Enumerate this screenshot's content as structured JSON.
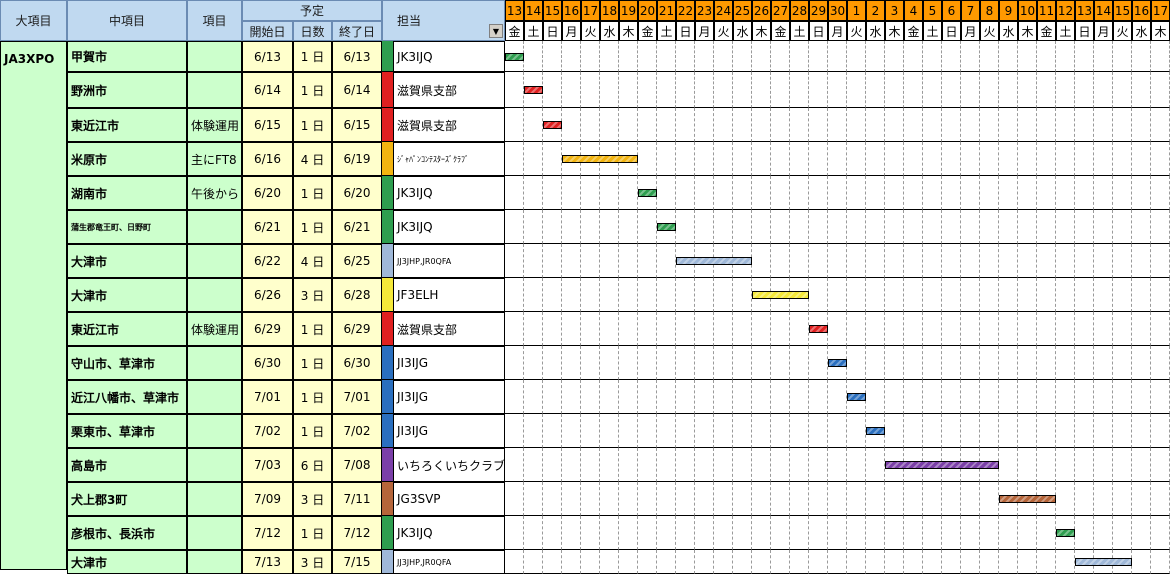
{
  "headers": {
    "major": "大項目",
    "middle": "中項目",
    "item": "項目",
    "plan": "予定",
    "start": "開始日",
    "days": "日数",
    "end": "終了日",
    "owner": "担当"
  },
  "major_value": "JA3XPO",
  "dates": [
    "13",
    "14",
    "15",
    "16",
    "17",
    "18",
    "19",
    "20",
    "21",
    "22",
    "23",
    "24",
    "25",
    "26",
    "27",
    "28",
    "29",
    "30",
    "1",
    "2",
    "3",
    "4",
    "5",
    "6",
    "7",
    "8",
    "9",
    "10",
    "11",
    "12",
    "13",
    "14",
    "15",
    "16",
    "17"
  ],
  "weekdays": [
    "金",
    "土",
    "日",
    "月",
    "火",
    "水",
    "木",
    "金",
    "土",
    "日",
    "月",
    "火",
    "水",
    "木",
    "金",
    "土",
    "日",
    "月",
    "火",
    "水",
    "木",
    "金",
    "土",
    "日",
    "月",
    "火",
    "水",
    "木",
    "金",
    "土",
    "日",
    "月",
    "火",
    "水",
    "木"
  ],
  "rows": [
    {
      "middle": "甲賀市",
      "item": "",
      "start": "6/13",
      "days": "1 日",
      "end": "6/13",
      "owner": "JK3IJQ",
      "color": "#2e9e4f",
      "offset": 0,
      "duration": 1
    },
    {
      "middle": "野洲市",
      "item": "",
      "start": "6/14",
      "days": "1 日",
      "end": "6/14",
      "owner": "滋賀県支部",
      "color": "#e02020",
      "offset": 1,
      "duration": 1
    },
    {
      "middle": "東近江市",
      "item": "体験運用",
      "start": "6/15",
      "days": "1 日",
      "end": "6/15",
      "owner": "滋賀県支部",
      "color": "#e02020",
      "offset": 2,
      "duration": 1
    },
    {
      "middle": "米原市",
      "item": "主にFT8",
      "start": "6/16",
      "days": "4 日",
      "end": "6/19",
      "owner": "ｼﾞｬﾊﾟﾝｺﾝﾃｽﾀｰｽﾞｸﾗﾌﾞ",
      "color": "#f2b410",
      "offset": 3,
      "duration": 4
    },
    {
      "middle": "湖南市",
      "item": "午後から",
      "start": "6/20",
      "days": "1 日",
      "end": "6/20",
      "owner": "JK3IJQ",
      "color": "#2e9e4f",
      "offset": 7,
      "duration": 1
    },
    {
      "middle": "蒲生郡竜王町、日野町",
      "item": "",
      "start": "6/21",
      "days": "1 日",
      "end": "6/21",
      "owner": "JK3IJQ",
      "color": "#2e9e4f",
      "offset": 8,
      "duration": 1
    },
    {
      "middle": "大津市",
      "item": "",
      "start": "6/22",
      "days": "4 日",
      "end": "6/25",
      "owner": "JJ3JHP,JR0QFA",
      "color": "#9fb8d8",
      "offset": 9,
      "duration": 4
    },
    {
      "middle": "大津市",
      "item": "",
      "start": "6/26",
      "days": "3 日",
      "end": "6/28",
      "owner": "JF3ELH",
      "color": "#f5e93a",
      "offset": 13,
      "duration": 3
    },
    {
      "middle": "東近江市",
      "item": "体験運用",
      "start": "6/29",
      "days": "1 日",
      "end": "6/29",
      "owner": "滋賀県支部",
      "color": "#e02020",
      "offset": 16,
      "duration": 1
    },
    {
      "middle": "守山市、草津市",
      "item": "",
      "start": "6/30",
      "days": "1 日",
      "end": "6/30",
      "owner": "JI3IJG",
      "color": "#2a6fbf",
      "offset": 17,
      "duration": 1
    },
    {
      "middle": "近江八幡市、草津市",
      "item": "",
      "start": "7/01",
      "days": "1 日",
      "end": "7/01",
      "owner": "JI3IJG",
      "color": "#2a6fbf",
      "offset": 18,
      "duration": 1
    },
    {
      "middle": "栗東市、草津市",
      "item": "",
      "start": "7/02",
      "days": "1 日",
      "end": "7/02",
      "owner": "JI3IJG",
      "color": "#2a6fbf",
      "offset": 19,
      "duration": 1
    },
    {
      "middle": "高島市",
      "item": "",
      "start": "7/03",
      "days": "6 日",
      "end": "7/08",
      "owner": "いちろくいちクラブ",
      "color": "#7b3fa8",
      "offset": 20,
      "duration": 6
    },
    {
      "middle": "犬上郡3町",
      "item": "",
      "start": "7/09",
      "days": "3 日",
      "end": "7/11",
      "owner": "JG3SVP",
      "color": "#b5653a",
      "offset": 26,
      "duration": 3
    },
    {
      "middle": "彦根市、長浜市",
      "item": "",
      "start": "7/12",
      "days": "1 日",
      "end": "7/12",
      "owner": "JK3IJQ",
      "color": "#2e9e4f",
      "offset": 29,
      "duration": 1
    },
    {
      "middle": "大津市",
      "item": "",
      "start": "7/13",
      "days": "3 日",
      "end": "7/15",
      "owner": "JJ3JHP,JR0QFA",
      "color": "#9fb8d8",
      "offset": 30,
      "duration": 3
    }
  ]
}
